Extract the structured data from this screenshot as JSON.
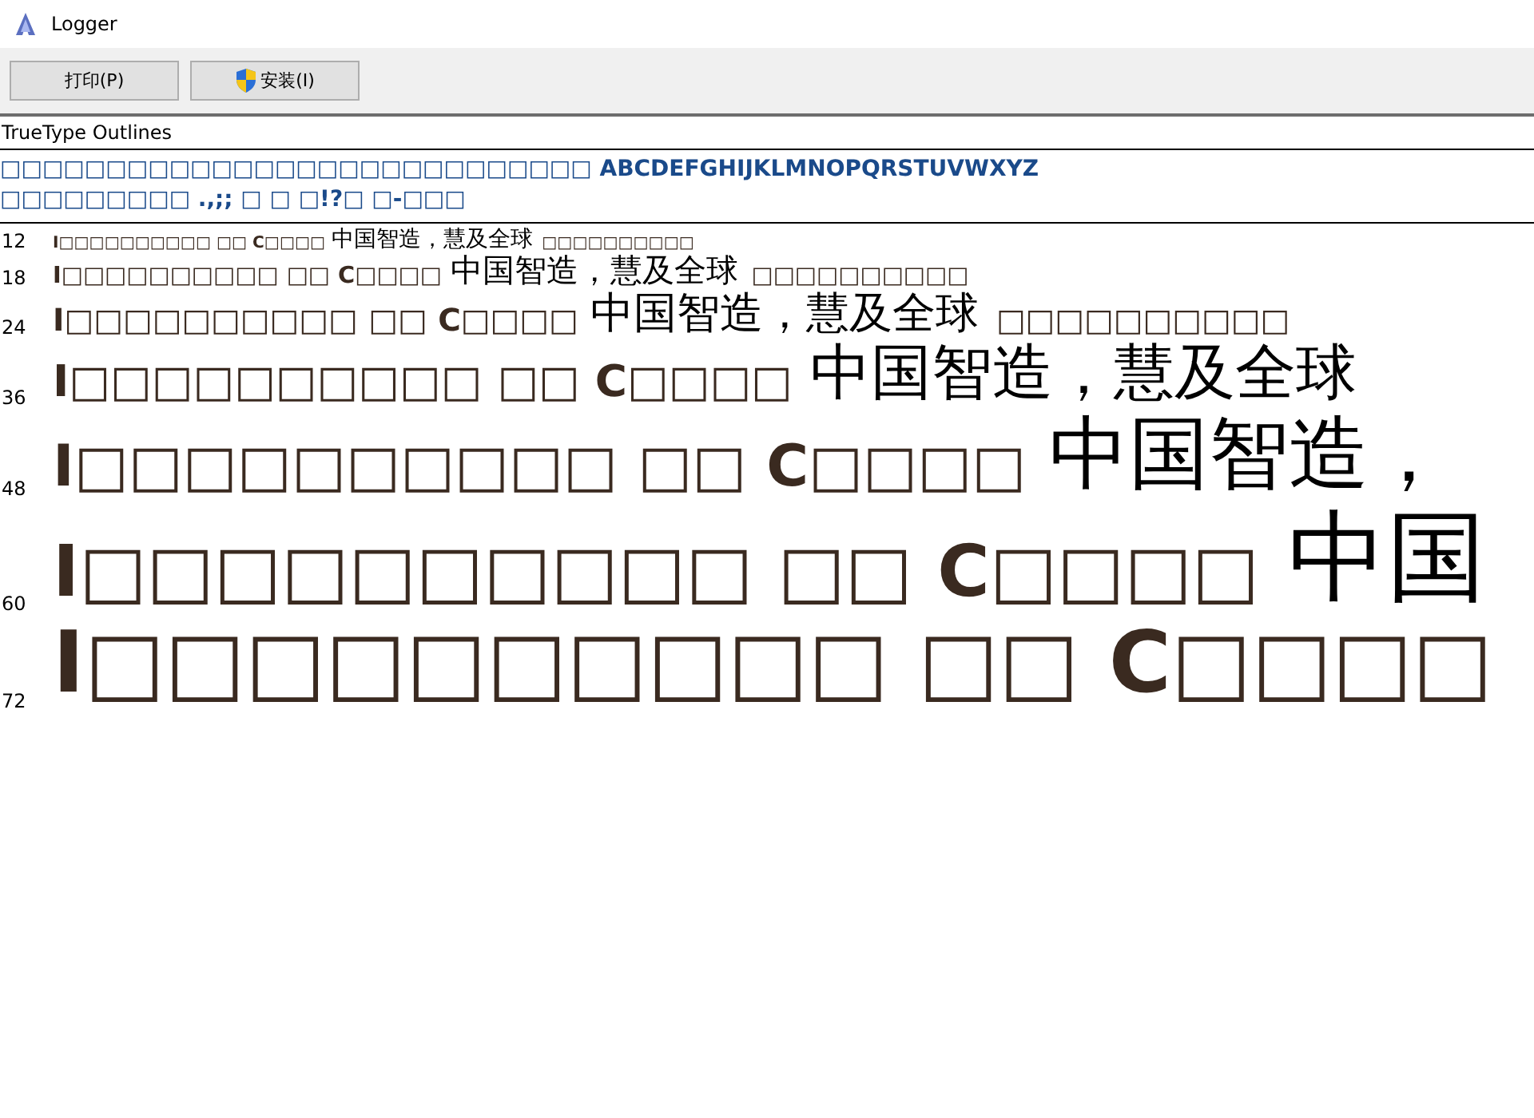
{
  "window": {
    "title": "Logger"
  },
  "toolbar": [
    {
      "label": "打印(P)",
      "kind": "plain"
    },
    {
      "label": "安装(I)",
      "kind": "shield"
    }
  ],
  "font_type": "TrueType Outlines",
  "charset_lines": [
    {
      "text": "□□□□□□□□□□□□□□□□□□□□□□□□□□□□ ABCDEFGHIJKLMNOPQRSTUVWXYZ"
    },
    {
      "text": "□□□□□□□□□ .,;; □ □ □!?□ □-□□□"
    }
  ],
  "samples": [
    {
      "size": "12",
      "segments": [
        {
          "kind": "latin",
          "text": "I□□□□□□□□□□ □□ C□□□□"
        },
        {
          "kind": "cjk",
          "text": "中国智造，慧及全球"
        },
        {
          "kind": "latin",
          "text": "□□□□□□□□□□"
        }
      ]
    },
    {
      "size": "18",
      "segments": [
        {
          "kind": "latin",
          "text": "I□□□□□□□□□□ □□ C□□□□"
        },
        {
          "kind": "cjk",
          "text": "中国智造，慧及全球"
        },
        {
          "kind": "latin",
          "text": "□□□□□□□□□□"
        }
      ]
    },
    {
      "size": "24",
      "segments": [
        {
          "kind": "latin",
          "text": "I□□□□□□□□□□ □□ C□□□□"
        },
        {
          "kind": "cjk",
          "text": "中国智造，慧及全球"
        },
        {
          "kind": "latin",
          "text": "□□□□□□□□□□"
        }
      ]
    },
    {
      "size": "36",
      "segments": [
        {
          "kind": "latin",
          "text": "I□□□□□□□□□□ □□ C□□□□"
        },
        {
          "kind": "cjk",
          "text": "中国智造，慧及全球"
        }
      ]
    },
    {
      "size": "48",
      "segments": [
        {
          "kind": "latin",
          "text": "I□□□□□□□□□□ □□ C□□□□"
        },
        {
          "kind": "cjk",
          "text": "中国智造，"
        }
      ]
    },
    {
      "size": "60",
      "segments": [
        {
          "kind": "latin",
          "text": "I□□□□□□□□□□ □□ C□□□□"
        },
        {
          "kind": "cjk",
          "text": "中国"
        }
      ]
    },
    {
      "size": "72",
      "segments": [
        {
          "kind": "latin",
          "text": "I□□□□□□□□□□ □□ C□□□□"
        }
      ]
    }
  ]
}
